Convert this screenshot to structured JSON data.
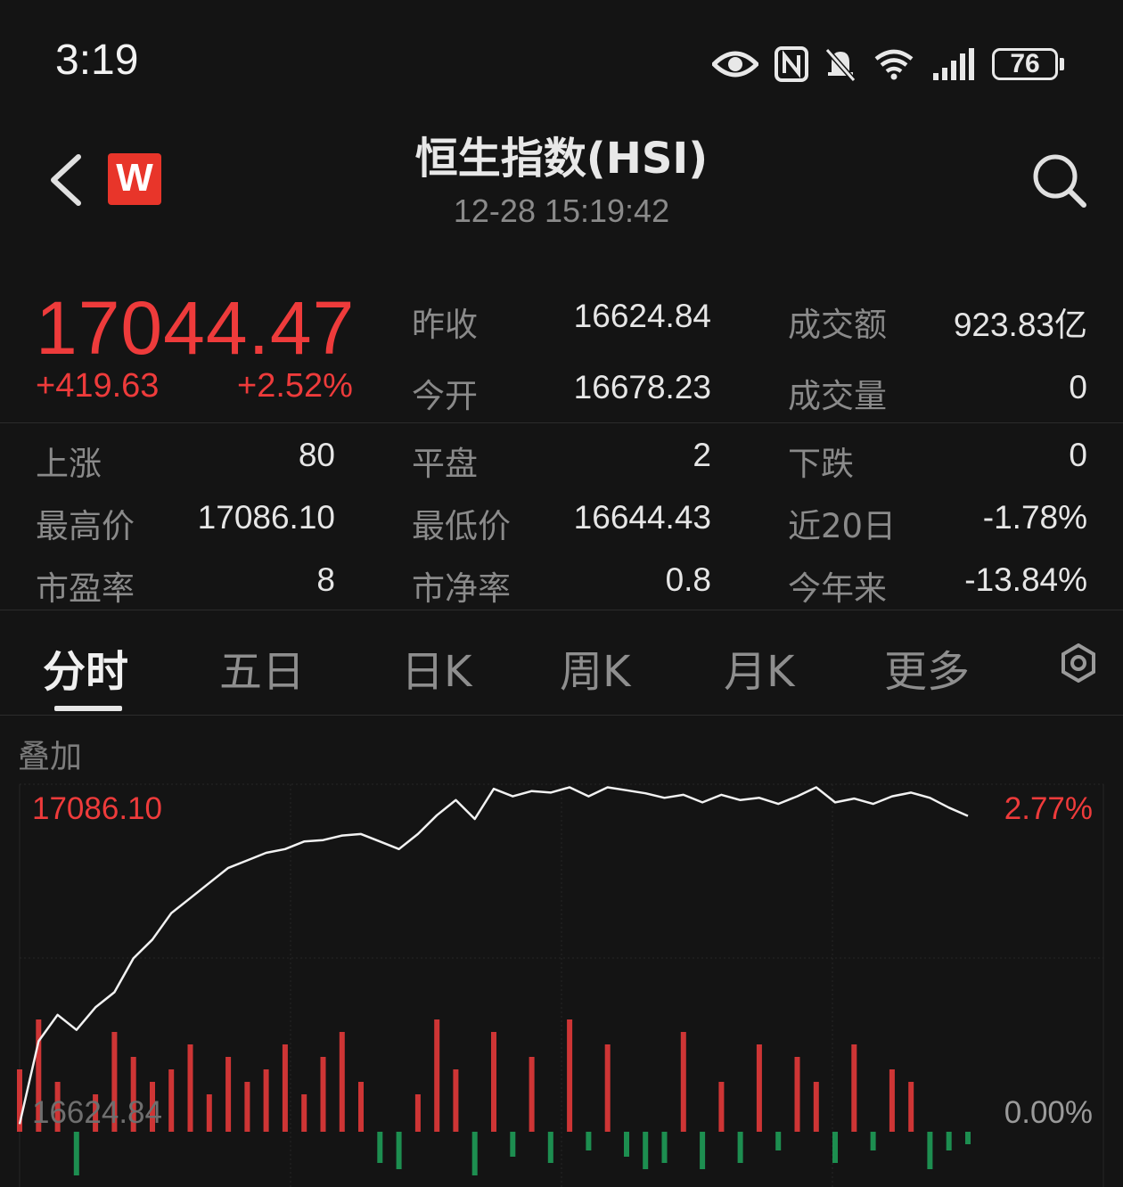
{
  "status_bar": {
    "time": "3:19",
    "battery": "76",
    "icons": [
      "eye-icon",
      "nfc-icon",
      "bell-muted-icon",
      "wifi-icon",
      "signal-icon",
      "battery-icon"
    ]
  },
  "header": {
    "title": "恒生指数(HSI)",
    "timestamp": "12-28 15:19:42",
    "logo_text": "W",
    "icons": [
      "back-arrow-icon",
      "search-icon"
    ]
  },
  "quote": {
    "price": "17044.47",
    "change": "+419.63",
    "change_pct": "+2.52%",
    "prev_close_label": "昨收",
    "prev_close": "16624.84",
    "open_label": "今开",
    "open": "16678.23",
    "turnover_label": "成交额",
    "turnover": "923.83亿",
    "volume_label": "成交量",
    "volume": "0"
  },
  "stats": {
    "up_label": "上涨",
    "up": "80",
    "flat_label": "平盘",
    "flat": "2",
    "down_label": "下跌",
    "down": "0",
    "high_label": "最高价",
    "high": "17086.10",
    "low_label": "最低价",
    "low": "16644.43",
    "d20_label": "近20日",
    "d20": "-1.78%",
    "pe_label": "市盈率",
    "pe": "8",
    "pb_label": "市净率",
    "pb": "0.8",
    "ytd_label": "今年来",
    "ytd": "-13.84%"
  },
  "tabs": {
    "items": [
      "分时",
      "五日",
      "日K",
      "周K",
      "月K",
      "更多"
    ],
    "active": "分时"
  },
  "chart": {
    "overlay_label": "叠加",
    "top_left": "17086.10",
    "top_right": "2.77%",
    "bottom_left": "16624.84",
    "bottom_right": "0.00%"
  },
  "colors": {
    "up": "#ee3b3b",
    "down": "#1fa35a",
    "background": "#141414"
  },
  "chart_data": {
    "type": "line",
    "y_range": [
      16624.84,
      17086.1
    ],
    "x": [
      0,
      2,
      4,
      6,
      8,
      10,
      12,
      14,
      16,
      18,
      20,
      22,
      24,
      26,
      28,
      30,
      32,
      34,
      36,
      38,
      40,
      42,
      44,
      46,
      48,
      50,
      52,
      54,
      56,
      58,
      60,
      62,
      64,
      66,
      68,
      70,
      72,
      74,
      76,
      78,
      80,
      82,
      84,
      86,
      88,
      90,
      92,
      94,
      96,
      98,
      100
    ],
    "y": [
      16635,
      16745,
      16780,
      16760,
      16790,
      16810,
      16855,
      16880,
      16915,
      16935,
      16955,
      16975,
      16985,
      16995,
      17000,
      17010,
      17012,
      17018,
      17020,
      17010,
      17000,
      17020,
      17045,
      17065,
      17040,
      17080,
      17070,
      17077,
      17075,
      17082,
      17070,
      17082,
      17078,
      17074,
      17068,
      17072,
      17062,
      17072,
      17065,
      17068,
      17060,
      17070,
      17082,
      17062,
      17067,
      17060,
      17070,
      17075,
      17068,
      17055,
      17044
    ],
    "volume": [
      5,
      9,
      4,
      7,
      3,
      8,
      6,
      4,
      5,
      7,
      3,
      6,
      4,
      5,
      7,
      3,
      6,
      8,
      4,
      5,
      6,
      3,
      9,
      5,
      7,
      8,
      4,
      6,
      5,
      9,
      3,
      7,
      4,
      6,
      5,
      8,
      6,
      4,
      5,
      7,
      3,
      6,
      4,
      5,
      7,
      3,
      5,
      4,
      6,
      3,
      2
    ]
  }
}
